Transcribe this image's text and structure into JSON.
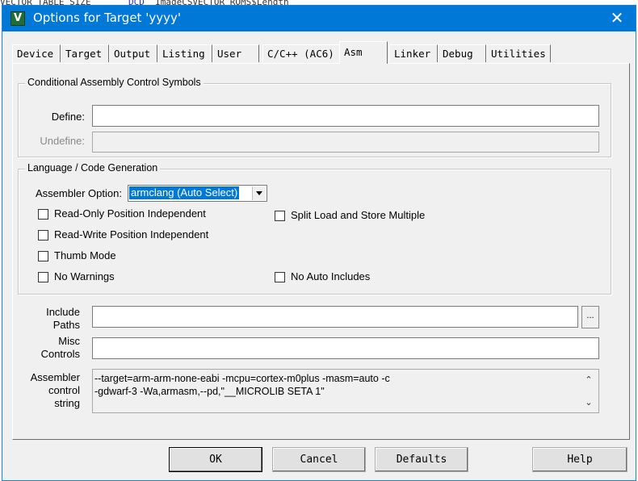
{
  "window": {
    "title": "Options for Target 'yyyy'",
    "close_glyph": "✕",
    "app_icon_glyph": "V",
    "background_text": [
      "VECTOR TABLE SIZE",
      "DCD",
      "ImageCSVECTOR ROMS$Length"
    ]
  },
  "tabs": [
    {
      "label": "Device",
      "active": false
    },
    {
      "label": "Target",
      "active": false
    },
    {
      "label": "Output",
      "active": false
    },
    {
      "label": "Listing",
      "active": false
    },
    {
      "label": "User",
      "active": false
    },
    {
      "label": "C/C++ (AC6)",
      "active": false
    },
    {
      "label": "Asm",
      "active": true
    },
    {
      "label": "Linker",
      "active": false
    },
    {
      "label": "Debug",
      "active": false
    },
    {
      "label": "Utilities",
      "active": false
    }
  ],
  "conditional": {
    "group_title": "Conditional Assembly Control Symbols",
    "define_label": "Define:",
    "define_value": "",
    "undefine_label": "Undefine:",
    "undefine_value": ""
  },
  "language": {
    "group_title": "Language / Code Generation",
    "assembler_option_label": "Assembler Option:",
    "assembler_option_value": "armclang (Auto Select)",
    "checkboxes": {
      "ropi": {
        "label": "Read-Only Position Independent",
        "checked": false
      },
      "rwpi": {
        "label": "Read-Write Position Independent",
        "checked": false
      },
      "thumb": {
        "label": "Thumb Mode",
        "checked": false
      },
      "no_warnings": {
        "label": "No Warnings",
        "checked": false
      },
      "split_load": {
        "label": "Split Load and Store Multiple",
        "checked": false
      },
      "no_auto_includes": {
        "label": "No Auto Includes",
        "checked": false
      }
    }
  },
  "include": {
    "label_line1": "Include",
    "label_line2": "Paths",
    "value": "",
    "browse_label": "..."
  },
  "misc": {
    "label_line1": "Misc",
    "label_line2": "Controls",
    "value": ""
  },
  "control_string": {
    "label_line1": "Assembler",
    "label_line2": "control",
    "label_line3": "string",
    "value": "--target=arm-arm-none-eabi -mcpu=cortex-m0plus -masm=auto -c\n-gdwarf-3 -Wa,armasm,--pd,\"__MICROLIB SETA 1\"",
    "scroll_up": "⌃",
    "scroll_down": "⌄"
  },
  "buttons": {
    "ok": "OK",
    "cancel": "Cancel",
    "defaults": "Defaults",
    "help": "Help"
  },
  "colors": {
    "titlebar": "#0078d7",
    "selection": "#0078d7",
    "dialog_bg": "#f0f0f0"
  }
}
